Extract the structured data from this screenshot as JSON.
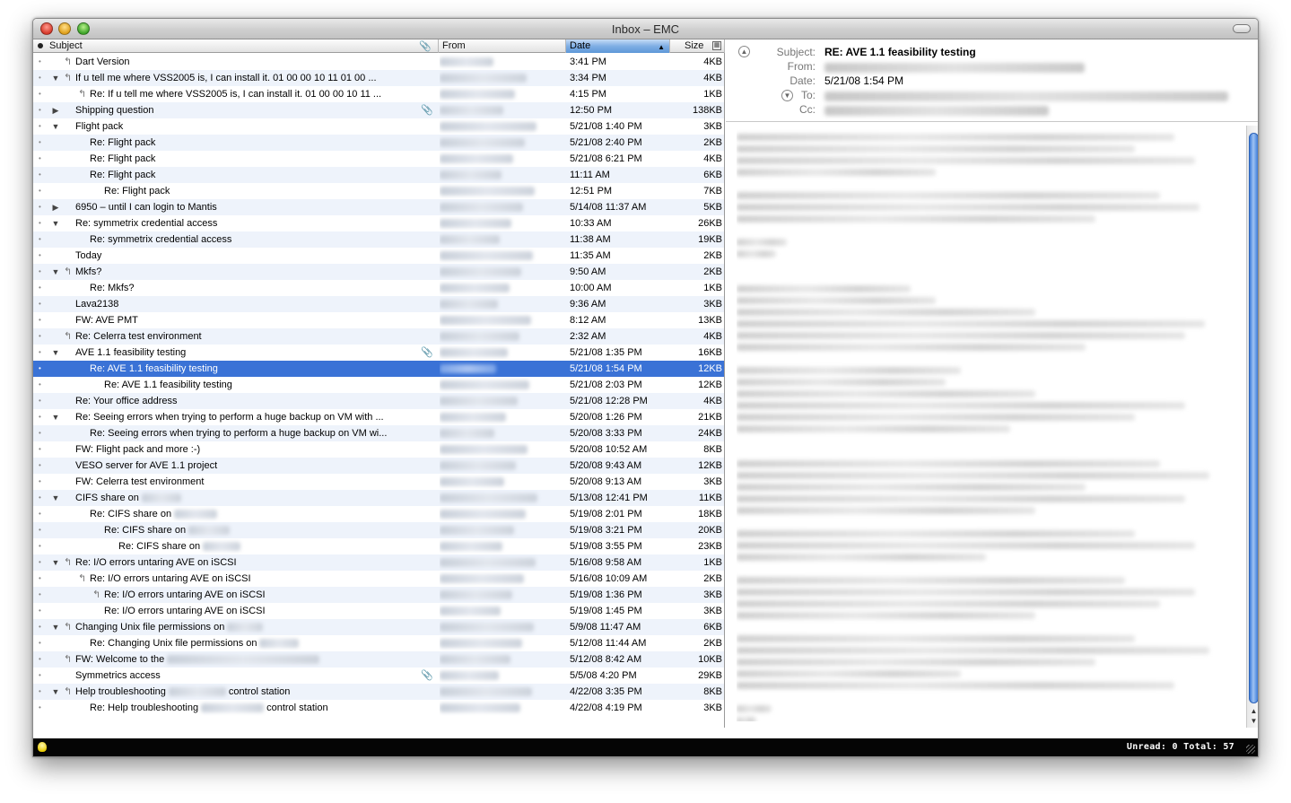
{
  "window": {
    "title": "Inbox – EMC"
  },
  "columns": {
    "subject": "Subject",
    "from": "From",
    "date": "Date",
    "size": "Size"
  },
  "messages": [
    {
      "subject": "Dart Version",
      "indent": 0,
      "tri": "",
      "replied": true,
      "attach": false,
      "date": "3:41 PM",
      "size": "4KB"
    },
    {
      "subject": "If u tell me where VSS2005 is, I can install it. 01 00 00 10 11 01 00 ...",
      "indent": 0,
      "tri": "open",
      "replied": true,
      "attach": false,
      "date": "3:34 PM",
      "size": "4KB"
    },
    {
      "subject": "Re: If u tell me where VSS2005 is, I can install it. 01 00 00 10 11 ...",
      "indent": 1,
      "tri": "",
      "replied": true,
      "attach": false,
      "date": "4:15 PM",
      "size": "1KB"
    },
    {
      "subject": "Shipping question",
      "indent": 0,
      "tri": "closed",
      "replied": false,
      "attach": true,
      "date": "12:50 PM",
      "size": "138KB"
    },
    {
      "subject": "Flight pack",
      "indent": 0,
      "tri": "open",
      "replied": false,
      "attach": false,
      "date": "5/21/08 1:40 PM",
      "size": "3KB"
    },
    {
      "subject": "Re: Flight pack",
      "indent": 1,
      "tri": "",
      "replied": false,
      "attach": false,
      "date": "5/21/08 2:40 PM",
      "size": "2KB"
    },
    {
      "subject": "Re: Flight pack",
      "indent": 1,
      "tri": "",
      "replied": false,
      "attach": false,
      "date": "5/21/08 6:21 PM",
      "size": "4KB"
    },
    {
      "subject": "Re: Flight pack",
      "indent": 1,
      "tri": "",
      "replied": false,
      "attach": false,
      "date": "11:11 AM",
      "size": "6KB"
    },
    {
      "subject": "Re: Flight pack",
      "indent": 2,
      "tri": "",
      "replied": false,
      "attach": false,
      "date": "12:51 PM",
      "size": "7KB"
    },
    {
      "subject": "6950 – until I can login to Mantis",
      "indent": 0,
      "tri": "closed",
      "replied": false,
      "attach": false,
      "date": "5/14/08 11:37 AM",
      "size": "5KB"
    },
    {
      "subject": "Re: symmetrix credential access",
      "indent": 0,
      "tri": "open",
      "replied": false,
      "attach": false,
      "date": "10:33 AM",
      "size": "26KB"
    },
    {
      "subject": "Re: symmetrix credential access",
      "indent": 1,
      "tri": "",
      "replied": false,
      "attach": false,
      "date": "11:38 AM",
      "size": "19KB"
    },
    {
      "subject": "Today",
      "indent": 0,
      "tri": "",
      "replied": false,
      "attach": false,
      "date": "11:35 AM",
      "size": "2KB"
    },
    {
      "subject": "Mkfs?",
      "indent": 0,
      "tri": "open",
      "replied": true,
      "attach": false,
      "date": "9:50 AM",
      "size": "2KB"
    },
    {
      "subject": "Re: Mkfs?",
      "indent": 1,
      "tri": "",
      "replied": false,
      "attach": false,
      "date": "10:00 AM",
      "size": "1KB"
    },
    {
      "subject": "Lava2138",
      "indent": 0,
      "tri": "",
      "replied": false,
      "attach": false,
      "date": "9:36 AM",
      "size": "3KB"
    },
    {
      "subject": "FW: AVE PMT",
      "indent": 0,
      "tri": "",
      "replied": false,
      "attach": false,
      "date": "8:12 AM",
      "size": "13KB"
    },
    {
      "subject": "Re: Celerra test environment",
      "indent": 0,
      "tri": "",
      "replied": true,
      "attach": false,
      "date": "2:32 AM",
      "size": "4KB"
    },
    {
      "subject": "AVE 1.1 feasibility testing",
      "indent": 0,
      "tri": "open",
      "replied": false,
      "attach": true,
      "date": "5/21/08 1:35 PM",
      "size": "16KB"
    },
    {
      "subject": "Re: AVE 1.1 feasibility testing",
      "indent": 1,
      "tri": "",
      "replied": false,
      "attach": false,
      "date": "5/21/08 1:54 PM",
      "size": "12KB",
      "selected": true
    },
    {
      "subject": "Re: AVE 1.1 feasibility testing",
      "indent": 2,
      "tri": "",
      "replied": false,
      "attach": false,
      "date": "5/21/08 2:03 PM",
      "size": "12KB"
    },
    {
      "subject": "Re: Your office address",
      "indent": 0,
      "tri": "",
      "replied": false,
      "attach": false,
      "date": "5/21/08 12:28 PM",
      "size": "4KB"
    },
    {
      "subject": "Re: Seeing errors when trying to perform a huge backup on VM with ...",
      "indent": 0,
      "tri": "open",
      "replied": false,
      "attach": false,
      "date": "5/20/08 1:26 PM",
      "size": "21KB"
    },
    {
      "subject": "Re: Seeing errors when trying to perform a huge backup on VM wi...",
      "indent": 1,
      "tri": "",
      "replied": false,
      "attach": false,
      "date": "5/20/08 3:33 PM",
      "size": "24KB"
    },
    {
      "subject": "FW: Flight pack and more :-)",
      "indent": 0,
      "tri": "",
      "replied": false,
      "attach": false,
      "date": "5/20/08 10:52 AM",
      "size": "8KB"
    },
    {
      "subject": "VESO server for AVE 1.1 project",
      "indent": 0,
      "tri": "",
      "replied": false,
      "attach": false,
      "date": "5/20/08 9:43 AM",
      "size": "12KB"
    },
    {
      "subject": "FW: Celerra test environment",
      "indent": 0,
      "tri": "",
      "replied": false,
      "attach": false,
      "date": "5/20/08 9:13 AM",
      "size": "3KB"
    },
    {
      "subject": "CIFS share on",
      "indent": 0,
      "tri": "open",
      "replied": false,
      "attach": false,
      "date": "5/13/08 12:41 PM",
      "size": "11KB",
      "redact": 44
    },
    {
      "subject": "Re: CIFS share on",
      "indent": 1,
      "tri": "",
      "replied": false,
      "attach": false,
      "date": "5/19/08 2:01 PM",
      "size": "18KB",
      "redact": 48
    },
    {
      "subject": "Re: CIFS share on",
      "indent": 2,
      "tri": "",
      "replied": false,
      "attach": false,
      "date": "5/19/08 3:21 PM",
      "size": "20KB",
      "redact": 46
    },
    {
      "subject": "Re: CIFS share on",
      "indent": 3,
      "tri": "",
      "replied": false,
      "attach": false,
      "date": "5/19/08 3:55 PM",
      "size": "23KB",
      "redact": 42
    },
    {
      "subject": "Re: I/O errors untaring AVE on iSCSI",
      "indent": 0,
      "tri": "open",
      "replied": true,
      "attach": false,
      "date": "5/16/08 9:58 AM",
      "size": "1KB"
    },
    {
      "subject": "Re: I/O errors untaring AVE on iSCSI",
      "indent": 1,
      "tri": "",
      "replied": true,
      "attach": false,
      "date": "5/16/08 10:09 AM",
      "size": "2KB"
    },
    {
      "subject": "Re: I/O errors untaring AVE on iSCSI",
      "indent": 2,
      "tri": "",
      "replied": true,
      "attach": false,
      "date": "5/19/08 1:36 PM",
      "size": "3KB"
    },
    {
      "subject": "Re: I/O errors untaring AVE on iSCSI",
      "indent": 2,
      "tri": "",
      "replied": false,
      "attach": false,
      "date": "5/19/08 1:45 PM",
      "size": "3KB"
    },
    {
      "subject": "Changing Unix file permissions on",
      "indent": 0,
      "tri": "open",
      "replied": true,
      "attach": false,
      "date": "5/9/08 11:47 AM",
      "size": "6KB",
      "redact": 40
    },
    {
      "subject": "Re: Changing Unix file permissions on",
      "indent": 1,
      "tri": "",
      "replied": false,
      "attach": false,
      "date": "5/12/08 11:44 AM",
      "size": "2KB",
      "redact": 44
    },
    {
      "subject": "FW: Welcome to the",
      "indent": 0,
      "tri": "",
      "replied": true,
      "attach": false,
      "date": "5/12/08 8:42 AM",
      "size": "10KB",
      "redact": 170
    },
    {
      "subject": "Symmetrics access",
      "indent": 0,
      "tri": "",
      "replied": false,
      "attach": true,
      "date": "5/5/08 4:20 PM",
      "size": "29KB"
    },
    {
      "subject": "Help troubleshooting",
      "indent": 0,
      "tri": "open",
      "replied": true,
      "attach": false,
      "date": "4/22/08 3:35 PM",
      "size": "8KB",
      "redact": 64,
      "suffix": "control station"
    },
    {
      "subject": "Re: Help troubleshooting",
      "indent": 1,
      "tri": "",
      "replied": false,
      "attach": false,
      "date": "4/22/08 4:19 PM",
      "size": "3KB",
      "redact": 70,
      "suffix": "control station"
    }
  ],
  "preview": {
    "labels": {
      "subject": "Subject:",
      "from": "From:",
      "date": "Date:",
      "to": "To:",
      "cc": "Cc:"
    },
    "subject": "RE: AVE 1.1 feasibility testing",
    "date": "5/21/08 1:54 PM"
  },
  "status": {
    "text": "Unread: 0   Total: 57"
  }
}
